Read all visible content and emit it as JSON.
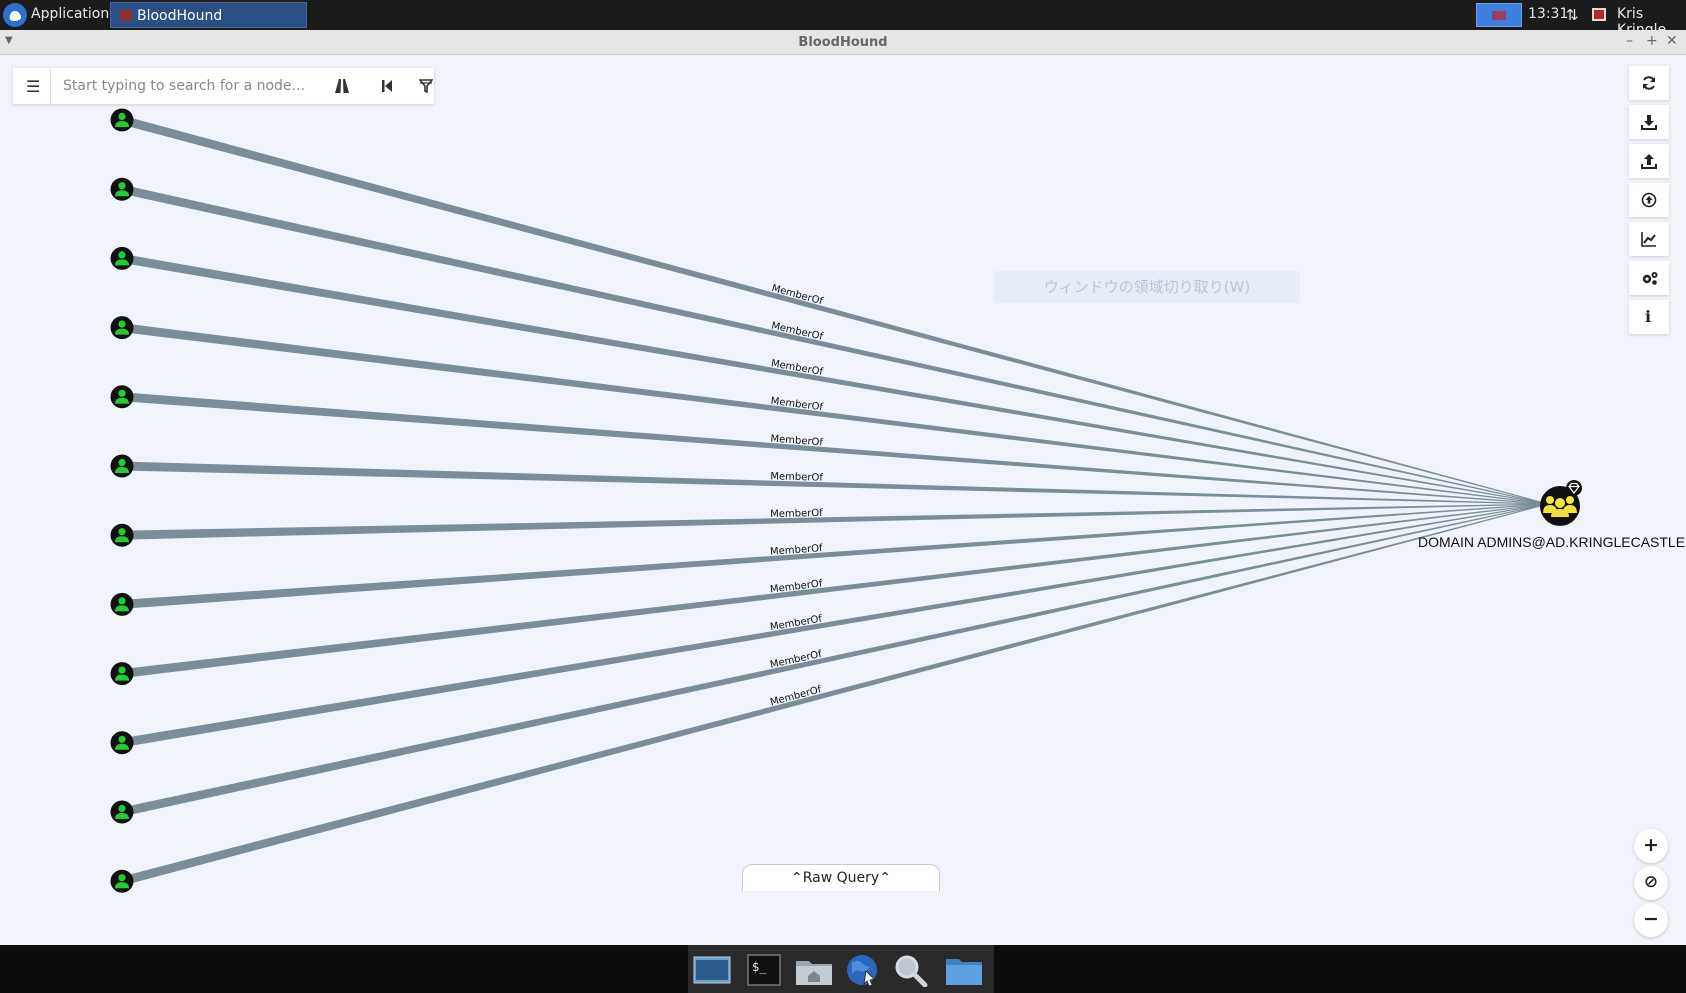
{
  "top_panel": {
    "applications_label": "Applications",
    "task_label": "BloodHound",
    "clock": "13:31",
    "user_name": "Kris Kringle"
  },
  "window": {
    "title": "BloodHound",
    "minimize_glyph": "–",
    "maximize_glyph": "+",
    "close_glyph": "✕"
  },
  "search": {
    "menu_glyph": "☰",
    "placeholder": "Start typing to search for a node...",
    "buttons": [
      "pathfinding-icon",
      "back-icon",
      "filter-icon"
    ]
  },
  "right_toolbar": [
    "refresh-icon",
    "export-icon",
    "import-icon",
    "upload-icon",
    "chart-icon",
    "settings-icon",
    "info-icon"
  ],
  "info_glyph": "i",
  "zoom": {
    "in_glyph": "+",
    "reset_glyph": "⊘",
    "out_glyph": "−"
  },
  "ghost_label": "ウィンドウの領域切り取り(W)",
  "graph": {
    "edge_label": "MemberOf",
    "user_node_count": 12,
    "target_label": "DOMAIN ADMINS@AD.KRINGLECASTLE.COM",
    "colors": {
      "edge": "#7a8d99",
      "user_icon": "#22cc33",
      "group_icon": "#f4e23c",
      "node_ring": "#111111"
    }
  },
  "raw_query_label": "Raw Query",
  "dock": [
    "desktop-icon",
    "terminal-icon",
    "home-folder-icon",
    "browser-icon",
    "search-icon",
    "folder-icon"
  ]
}
